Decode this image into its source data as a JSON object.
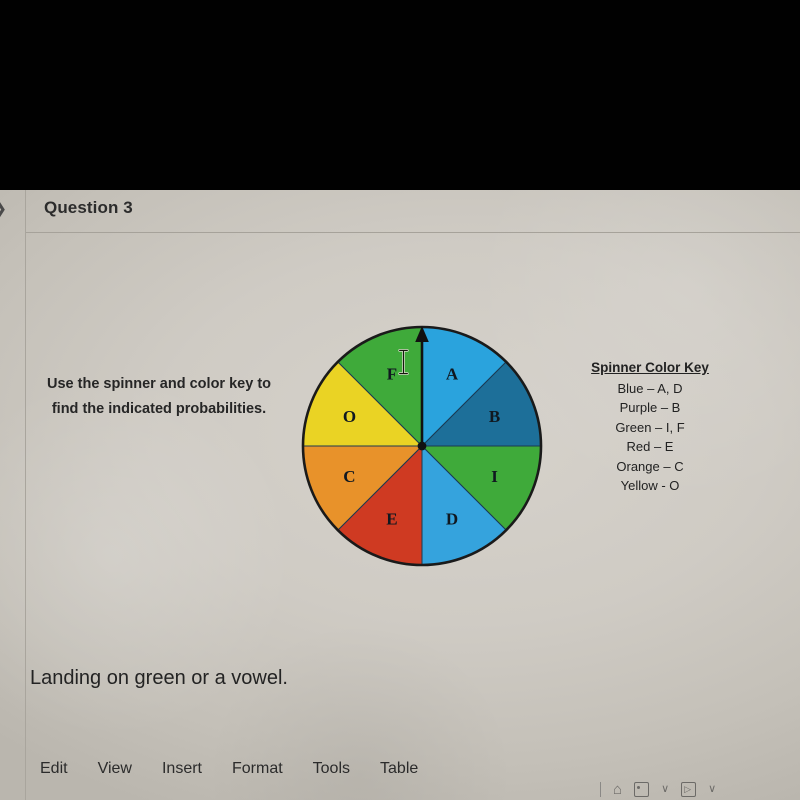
{
  "window": {
    "question_header": "Question 3"
  },
  "content": {
    "instructions": "Use the spinner and color key to find the indicated probabilities.",
    "prompt": "Landing on green or a vowel."
  },
  "color_key": {
    "title": "Spinner Color Key",
    "entries": [
      "Blue – A, D",
      "Purple – B",
      "Green – I, F",
      "Red – E",
      "Orange – C",
      "Yellow - O"
    ]
  },
  "menubar": {
    "items": [
      "Edit",
      "View",
      "Insert",
      "Format",
      "Tools",
      "Table"
    ]
  },
  "toolbar": {
    "divider": "|",
    "caret_a": "∨",
    "caret_b": "∨",
    "image_glyph": "",
    "media_glyph": "▷"
  },
  "cursor": {
    "type": "i-beam-text-cursor"
  },
  "chart_data": {
    "type": "pie",
    "title": "Spinner",
    "equal_sectors": true,
    "sector_count": 8,
    "start_angle_deg": 0,
    "direction": "clockwise",
    "categories": [
      "A",
      "B",
      "I",
      "D",
      "E",
      "C",
      "O",
      "F"
    ],
    "values": [
      45,
      45,
      45,
      45,
      45,
      45,
      45,
      45
    ],
    "colors": [
      "#2aa3dd",
      "#1d6f99",
      "#3faa3a",
      "#35a3dd",
      "#cf3a22",
      "#e8922a",
      "#ead324",
      "#3faa3a"
    ],
    "color_names": [
      "blue",
      "purple",
      "green",
      "blue",
      "red",
      "orange",
      "yellow",
      "green"
    ],
    "pointer": "up",
    "probability_each": "1/8",
    "legend_position": "right",
    "xlabel": "",
    "ylabel": ""
  }
}
